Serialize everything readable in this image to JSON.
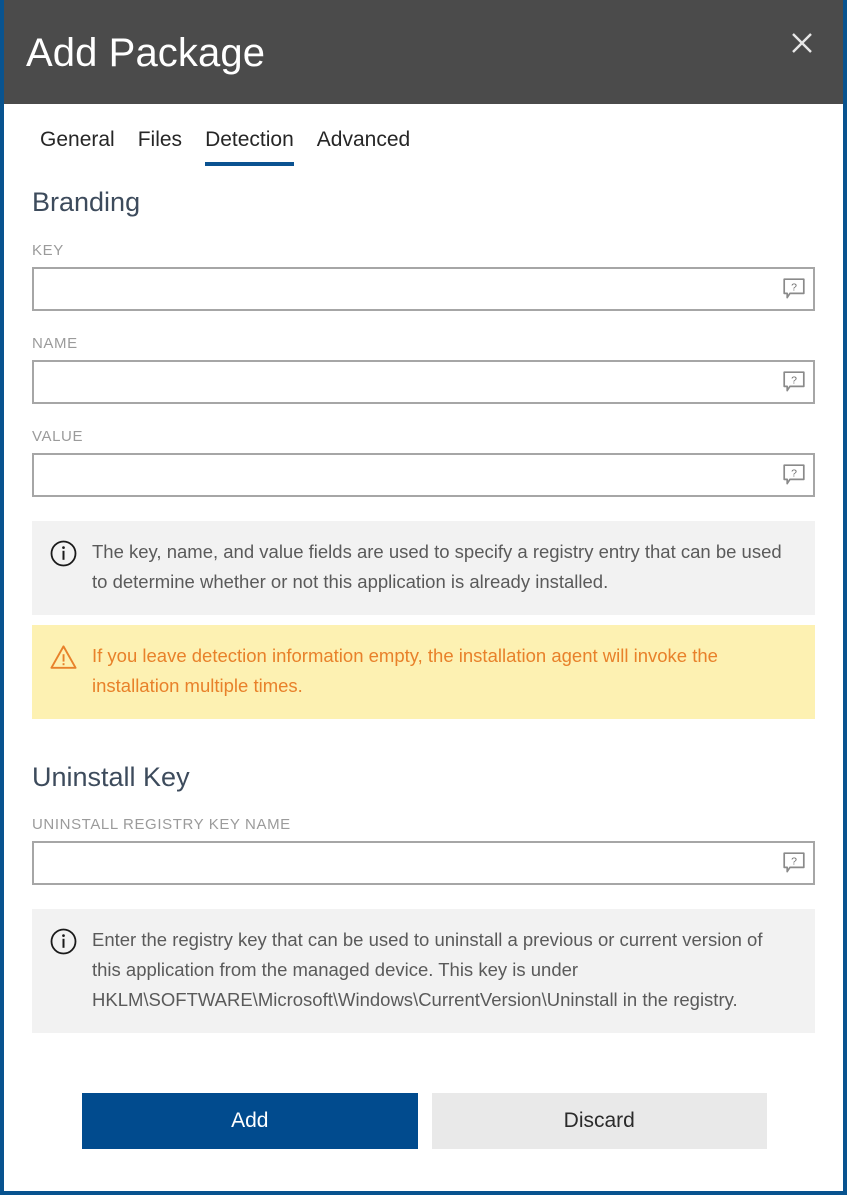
{
  "window": {
    "title": "Add Package",
    "close_icon": "close-icon",
    "accent_color": "#08538f",
    "titlebar_color": "#4b4b4b"
  },
  "tabs": [
    {
      "label": "General",
      "active": false
    },
    {
      "label": "Files",
      "active": false
    },
    {
      "label": "Detection",
      "active": true
    },
    {
      "label": "Advanced",
      "active": false
    }
  ],
  "sections": {
    "branding": {
      "heading": "Branding",
      "fields": [
        {
          "label": "KEY",
          "value": "",
          "placeholder": "",
          "help_icon": "help-bubble-icon"
        },
        {
          "label": "NAME",
          "value": "",
          "placeholder": "",
          "help_icon": "help-bubble-icon"
        },
        {
          "label": "VALUE",
          "value": "",
          "placeholder": "",
          "help_icon": "help-bubble-icon"
        }
      ],
      "info": {
        "icon": "info-circle-icon",
        "text": "The key, name, and value fields are used to specify a registry entry that can be used to determine whether or not this application is already installed."
      },
      "warning": {
        "icon": "warning-triangle-icon",
        "text": "If you leave detection information empty, the installation agent will invoke the installation multiple times.",
        "background_color": "#fdf1b2",
        "text_color": "#e8812a"
      }
    },
    "uninstall": {
      "heading": "Uninstall Key",
      "field": {
        "label": "UNINSTALL REGISTRY KEY NAME",
        "value": "",
        "placeholder": "",
        "help_icon": "help-bubble-icon"
      },
      "info": {
        "icon": "info-circle-icon",
        "text": "Enter the registry key that can be used to uninstall a previous or current version of this application from the managed device. This key is under HKLM\\SOFTWARE\\Microsoft\\Windows\\CurrentVersion\\Uninstall in the registry."
      }
    }
  },
  "footer": {
    "primary_label": "Add",
    "secondary_label": "Discard",
    "primary_color": "#014b8e",
    "secondary_color": "#e9e9e9"
  }
}
